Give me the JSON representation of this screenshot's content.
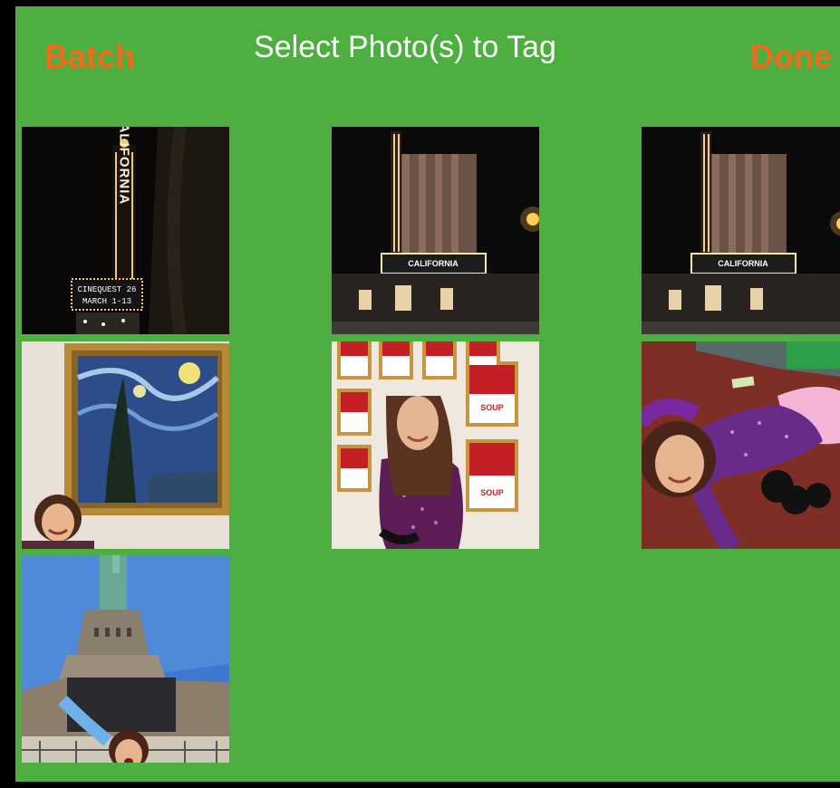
{
  "header": {
    "batch_label": "Batch",
    "title": "Select Photo(s) to Tag",
    "done_label": "Done"
  },
  "colors": {
    "background": "#4caf3f",
    "accent": "#f26b1d",
    "title": "#ffffff"
  },
  "photos": [
    {
      "subject": "theater-marquee-vertical",
      "sign_text": "CALIFORNIA",
      "marquee_lines": [
        "CINEQUEST 26",
        "MARCH 1-13"
      ]
    },
    {
      "subject": "theater-night-exterior",
      "sign_text": "CALIFORNIA"
    },
    {
      "subject": "theater-night-exterior",
      "sign_text": "CALIFORNIA"
    },
    {
      "subject": "painting-gallery-girl"
    },
    {
      "subject": "soup-cans-girl",
      "can_text": "SOUP"
    },
    {
      "subject": "girl-lying-on-floor"
    },
    {
      "subject": "statue-of-liberty-girl"
    }
  ]
}
